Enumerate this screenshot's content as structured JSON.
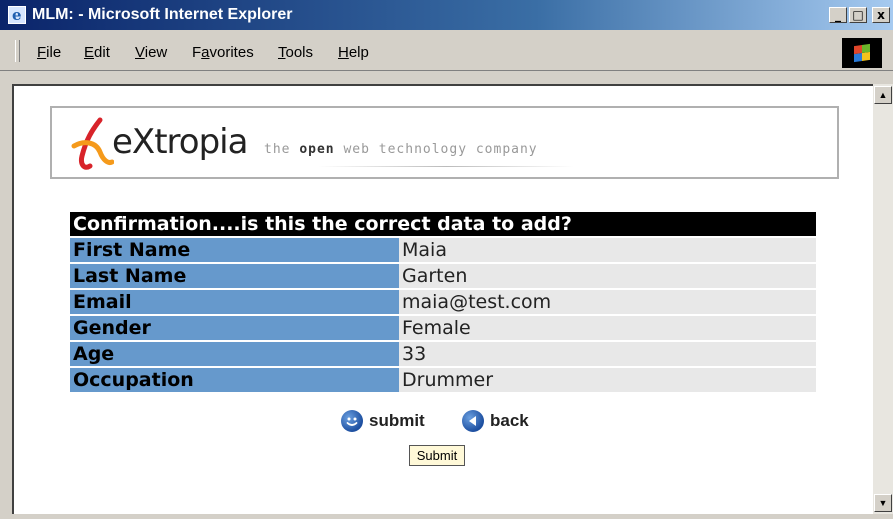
{
  "window": {
    "title": "MLM: - Microsoft Internet Explorer",
    "minimize_glyph": "_",
    "maximize_glyph": "□",
    "close_glyph": "x"
  },
  "menu": {
    "items": [
      {
        "prefix": "",
        "underline": "F",
        "rest": "ile"
      },
      {
        "prefix": "",
        "underline": "E",
        "rest": "dit"
      },
      {
        "prefix": "",
        "underline": "V",
        "rest": "iew"
      },
      {
        "prefix": "F",
        "underline": "a",
        "rest": "vorites"
      },
      {
        "prefix": "",
        "underline": "T",
        "rest": "ools"
      },
      {
        "prefix": "",
        "underline": "H",
        "rest": "elp"
      }
    ]
  },
  "banner": {
    "logo_word": "eXtropia",
    "tagline_pre": "the ",
    "tagline_bold": "open",
    "tagline_post": " web technology company"
  },
  "confirmation": {
    "heading": "Confirmation....is this the correct data to add?",
    "rows": [
      {
        "label": "First Name",
        "value": "Maia"
      },
      {
        "label": "Last Name",
        "value": "Garten"
      },
      {
        "label": "Email",
        "value": "maia@test.com"
      },
      {
        "label": "Gender",
        "value": "Female"
      },
      {
        "label": "Age",
        "value": "33"
      },
      {
        "label": "Occupation",
        "value": "Drummer"
      }
    ]
  },
  "actions": {
    "submit_label": "submit",
    "back_label": "back",
    "submit_button": "Submit"
  },
  "colors": {
    "label_bg": "#6699cc",
    "value_bg": "#e8e8e8",
    "header_bg": "#000000",
    "title_bar": "#0a246a"
  }
}
